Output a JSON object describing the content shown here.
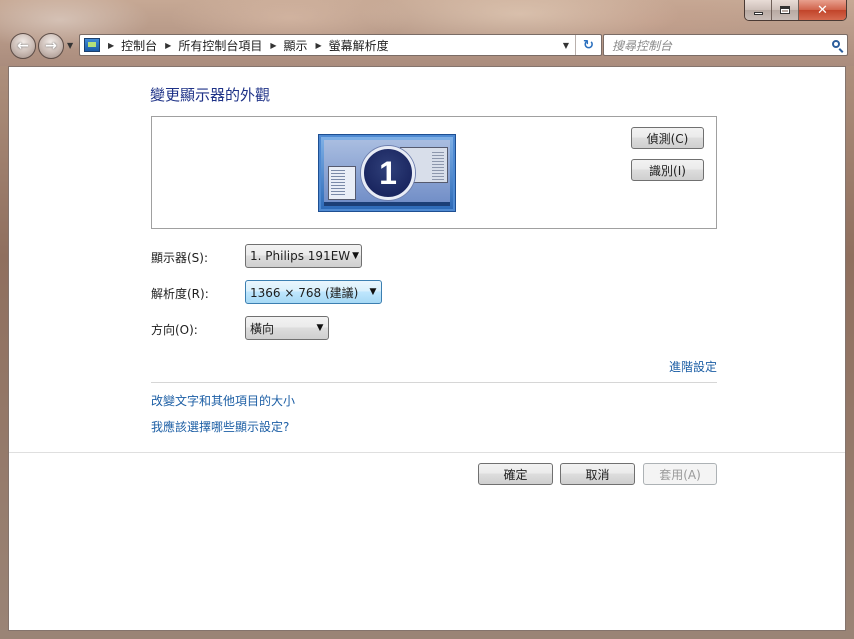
{
  "window": {
    "minimize_icon": "minimize-icon",
    "maximize_icon": "maximize-icon",
    "close_glyph": "✕"
  },
  "nav": {
    "back_icon": "back-arrow-icon",
    "forward_icon": "forward-arrow-icon"
  },
  "address": {
    "breadcrumbs": [
      "控制台",
      "所有控制台項目",
      "顯示",
      "螢幕解析度"
    ],
    "refresh_icon": "refresh-icon"
  },
  "search": {
    "placeholder": "搜尋控制台"
  },
  "page": {
    "title": "變更顯示器的外觀",
    "monitor_number": "1"
  },
  "buttons": {
    "detect": "偵測(C)",
    "identify": "識別(I)",
    "ok": "確定",
    "cancel": "取消",
    "apply": "套用(A)"
  },
  "fields": {
    "display_label": "顯示器(S):",
    "display_value": "1. Philips 191EW",
    "resolution_label": "解析度(R):",
    "resolution_value": "1366 × 768 (建議)",
    "orientation_label": "方向(O):",
    "orientation_value": "橫向"
  },
  "links": {
    "advanced": "進階設定",
    "text_size": "改變文字和其他項目的大小",
    "help": "我應該選擇哪些顯示設定?"
  },
  "colors": {
    "title": "#1e3287",
    "link": "#1d5fa5",
    "focus_border": "#3c7fb1"
  }
}
